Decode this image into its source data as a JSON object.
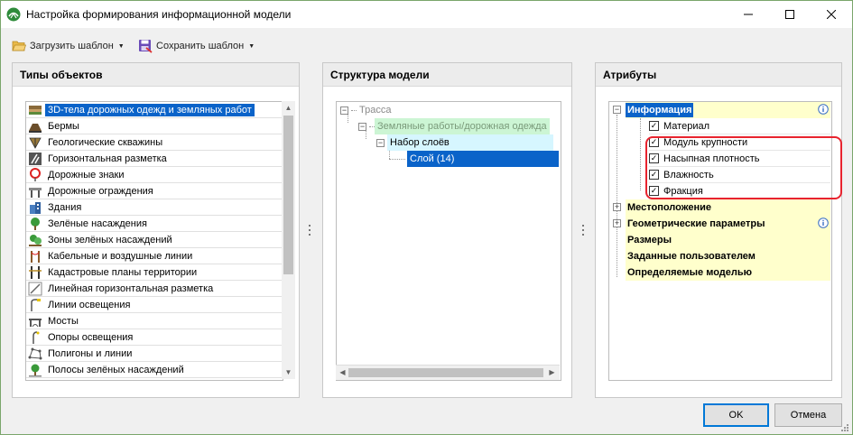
{
  "window": {
    "title": "Настройка формирования информационной модели"
  },
  "toolbar": {
    "load_label": "Загрузить шаблон",
    "save_label": "Сохранить шаблон"
  },
  "panels": {
    "types_title": "Типы объектов",
    "structure_title": "Структура модели",
    "attributes_title": "Атрибуты"
  },
  "object_types": [
    {
      "label": "3D-тела дорожных одежд и земляных работ",
      "icon": "earthwork-body-icon",
      "selected": true
    },
    {
      "label": "Бермы",
      "icon": "berm-icon"
    },
    {
      "label": "Геологические скважины",
      "icon": "borehole-icon"
    },
    {
      "label": "Горизонтальная разметка",
      "icon": "road-marking-icon"
    },
    {
      "label": "Дорожные знаки",
      "icon": "road-sign-icon"
    },
    {
      "label": "Дорожные ограждения",
      "icon": "road-barrier-icon"
    },
    {
      "label": "Здания",
      "icon": "building-icon"
    },
    {
      "label": "Зелёные насаждения",
      "icon": "tree-icon"
    },
    {
      "label": "Зоны зелёных насаждений",
      "icon": "green-zone-icon"
    },
    {
      "label": "Кабельные и воздушные линии",
      "icon": "cable-line-icon"
    },
    {
      "label": "Кадастровые планы территории",
      "icon": "cadastral-plan-icon"
    },
    {
      "label": "Линейная горизонтальная разметка",
      "icon": "linear-marking-icon"
    },
    {
      "label": "Линии освещения",
      "icon": "lighting-line-icon"
    },
    {
      "label": "Мосты",
      "icon": "bridge-icon"
    },
    {
      "label": "Опоры освещения",
      "icon": "lamp-post-icon"
    },
    {
      "label": "Полигоны и линии",
      "icon": "polygon-icon"
    },
    {
      "label": "Полосы зелёных насаждений",
      "icon": "green-strip-icon"
    }
  ],
  "structure": {
    "root": "Трасса",
    "level1": "Земляные работы/дорожная одежда",
    "level2": "Набор слоёв",
    "level3": "Слой (14)"
  },
  "attributes": {
    "info_group": "Информация",
    "info_children": [
      {
        "label": "Материал",
        "checked": true
      },
      {
        "label": "Модуль крупности",
        "checked": true
      },
      {
        "label": "Насыпная плотность",
        "checked": true
      },
      {
        "label": "Влажность",
        "checked": true
      },
      {
        "label": "Фракция",
        "checked": true
      }
    ],
    "location": "Местоположение",
    "geometry": "Геометрические параметры",
    "sizes": "Размеры",
    "user_defined": "Заданные пользователем",
    "model_defined": "Определяемые моделью"
  },
  "buttons": {
    "ok": "OK",
    "cancel": "Отмена"
  },
  "colors": {
    "selection": "#0a63c9",
    "group_bg": "#ffffcc",
    "highlight": "#e8232e",
    "tree_green": "#ccf5d4",
    "tree_cyan": "#d6f6ff"
  }
}
